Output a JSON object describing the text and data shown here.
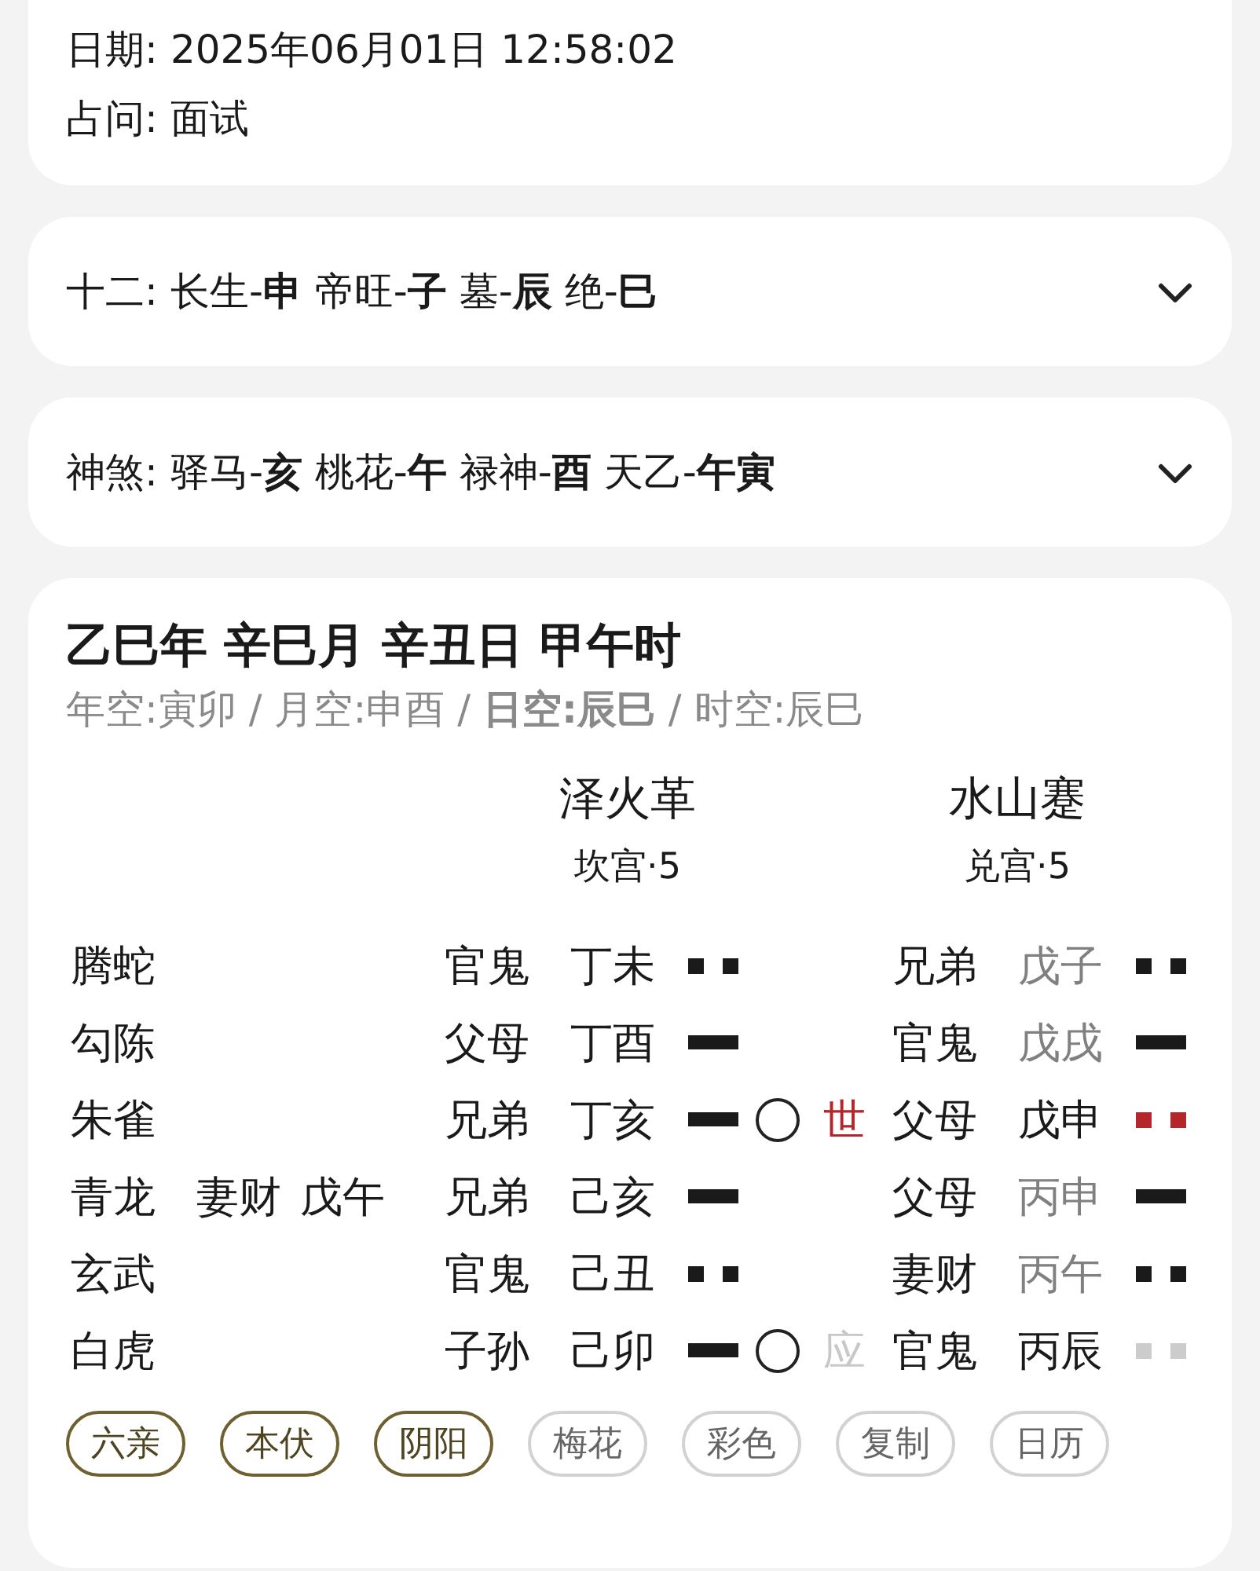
{
  "info": {
    "rows": [
      {
        "label": "日期:",
        "value": "2025年06月01日 12:58:02"
      },
      {
        "label": "占问:",
        "value": "面试"
      }
    ]
  },
  "panels": [
    {
      "label": "十二:",
      "text": "长生-**申** 帝旺-**子** 墓-**辰** 绝-**巳**",
      "expanded": false
    },
    {
      "label": "神煞:",
      "text": "驿马-**亥** 桃花-**午** 禄神-**酉** 天乙-**午寅**",
      "expanded": false
    }
  ],
  "chart": {
    "title": "乙巳年 辛巳月 辛丑日 甲午时",
    "void_line": "年空:寅卯 / 月空:申酉 / **日空:辰巳** / 时空:辰巳",
    "hexagrams": [
      {
        "name": "泽火革",
        "palace": "坎宫·5"
      },
      {
        "name": "水山蹇",
        "palace": "兑宫·5"
      }
    ],
    "rows": [
      {
        "spirit": "腾蛇",
        "main": {
          "relation": "官鬼",
          "branch": "丁未",
          "kind": "yin"
        },
        "changed": {
          "relation": "兄弟",
          "branch": "戊子",
          "dimmed": true,
          "kind": "yin",
          "color": "#1a1a1a"
        }
      },
      {
        "spirit": "勾陈",
        "main": {
          "relation": "父母",
          "branch": "丁酉",
          "kind": "yang"
        },
        "changed": {
          "relation": "官鬼",
          "branch": "戊戌",
          "dimmed": true,
          "kind": "yang",
          "color": "#1a1a1a"
        }
      },
      {
        "spirit": "朱雀",
        "main": {
          "relation": "兄弟",
          "branch": "丁亥",
          "kind": "yang"
        },
        "moving": true,
        "marker": {
          "kind": "shi",
          "text": "世"
        },
        "changed": {
          "relation": "父母",
          "branch": "戊申",
          "dimmed": false,
          "kind": "yin",
          "color": "#b3262a"
        }
      },
      {
        "spirit": "青龙",
        "hidden": {
          "relation": "妻财",
          "branch": "戊午"
        },
        "main": {
          "relation": "兄弟",
          "branch": "己亥",
          "kind": "yang"
        },
        "changed": {
          "relation": "父母",
          "branch": "丙申",
          "dimmed": true,
          "kind": "yang",
          "color": "#1a1a1a"
        }
      },
      {
        "spirit": "玄武",
        "main": {
          "relation": "官鬼",
          "branch": "己丑",
          "kind": "yin"
        },
        "changed": {
          "relation": "妻财",
          "branch": "丙午",
          "dimmed": true,
          "kind": "yin",
          "color": "#1a1a1a"
        }
      },
      {
        "spirit": "白虎",
        "main": {
          "relation": "子孙",
          "branch": "己卯",
          "kind": "yang"
        },
        "moving": true,
        "marker": {
          "kind": "ying",
          "text": "应"
        },
        "changed": {
          "relation": "官鬼",
          "branch": "丙辰",
          "dimmed": false,
          "kind": "yin",
          "color": "#cccccc"
        }
      }
    ],
    "chips": [
      {
        "label": "六亲",
        "selected": true
      },
      {
        "label": "本伏",
        "selected": true
      },
      {
        "label": "阴阳",
        "selected": true
      },
      {
        "label": "梅花",
        "selected": false
      },
      {
        "label": "彩色",
        "selected": false
      },
      {
        "label": "复制",
        "selected": false
      },
      {
        "label": "日历",
        "selected": false
      }
    ]
  }
}
